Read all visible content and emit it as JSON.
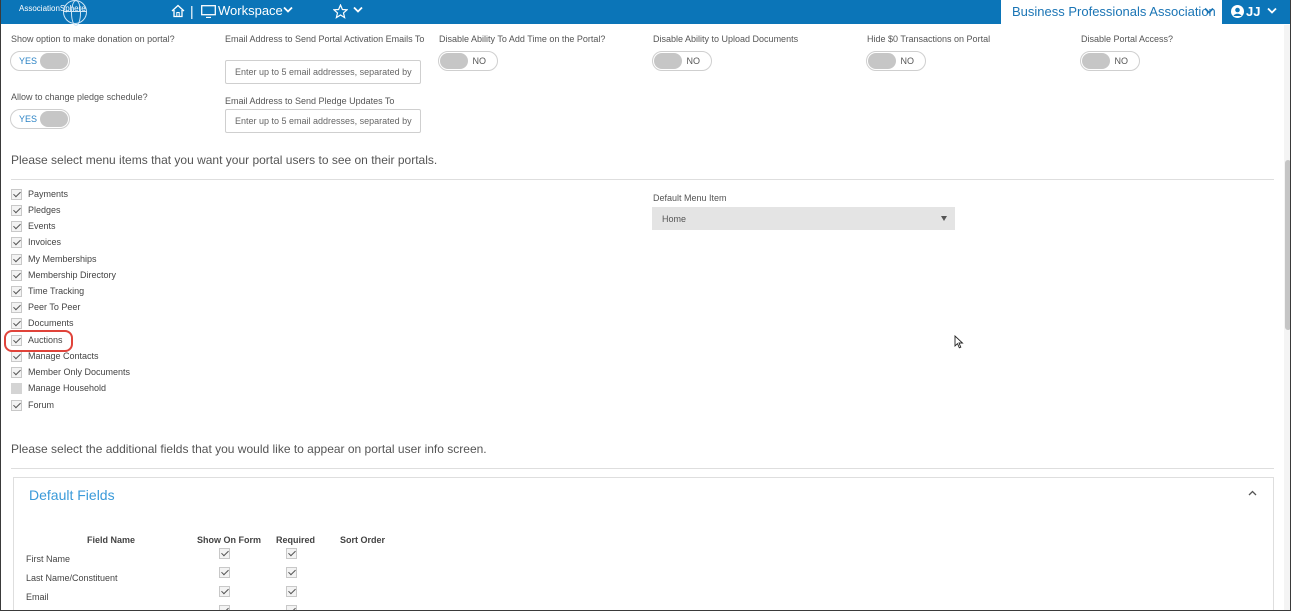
{
  "topbar": {
    "logo_text": "AssociationSphere",
    "separator": "|",
    "workspace_label": "Workspace",
    "org_name": "Business Professionals Association",
    "user_initials": "JJ",
    "bar_color": "#0b75b8"
  },
  "settings": {
    "donation": {
      "label": "Show option to make donation on portal?",
      "value": "YES"
    },
    "activation_email": {
      "label": "Email Address to Send Portal Activation Emails To",
      "placeholder": "Enter up to 5 email addresses, separated by"
    },
    "add_time": {
      "label": "Disable Ability To Add Time on the Portal?",
      "value": "NO"
    },
    "upload_docs": {
      "label": "Disable Ability to Upload Documents",
      "value": "NO"
    },
    "hide_zero": {
      "label": "Hide $0 Transactions on Portal",
      "value": "NO"
    },
    "disable_access": {
      "label": "Disable Portal Access?",
      "value": "NO"
    },
    "pledge_schedule": {
      "label": "Allow to change pledge schedule?",
      "value": "YES"
    },
    "pledge_email": {
      "label": "Email Address to Send Pledge Updates To",
      "placeholder": "Enter up to 5 email addresses, separated by"
    }
  },
  "menu_section": {
    "title": "Please select menu items that you want your portal users to see on their portals.",
    "items": [
      {
        "label": "Payments",
        "checked": true
      },
      {
        "label": "Pledges",
        "checked": true
      },
      {
        "label": "Events",
        "checked": true
      },
      {
        "label": "Invoices",
        "checked": true
      },
      {
        "label": "My Memberships",
        "checked": true
      },
      {
        "label": "Membership Directory",
        "checked": true
      },
      {
        "label": "Time Tracking",
        "checked": true
      },
      {
        "label": "Peer To Peer",
        "checked": true
      },
      {
        "label": "Documents",
        "checked": true
      },
      {
        "label": "Auctions",
        "checked": true
      },
      {
        "label": "Manage Contacts",
        "checked": true
      },
      {
        "label": "Member Only Documents",
        "checked": true
      },
      {
        "label": "Manage Household",
        "checked": false
      },
      {
        "label": "Forum",
        "checked": true
      }
    ],
    "default_menu_label": "Default Menu Item",
    "default_menu_value": "Home"
  },
  "fields_section": {
    "title": "Please select the additional fields that you would like to appear on portal user info screen.",
    "panel_title": "Default Fields",
    "columns": [
      "Field Name",
      "Show On Form",
      "Required",
      "Sort Order"
    ],
    "rows": [
      {
        "name": "First Name",
        "show": true,
        "required": true
      },
      {
        "name": "Last Name/Constituent",
        "show": true,
        "required": true
      },
      {
        "name": "Email",
        "show": true,
        "required": true
      }
    ]
  },
  "colors": {
    "accent": "#0b75b8",
    "highlight": "#e0433a",
    "link_blue": "#3a9ad9"
  }
}
